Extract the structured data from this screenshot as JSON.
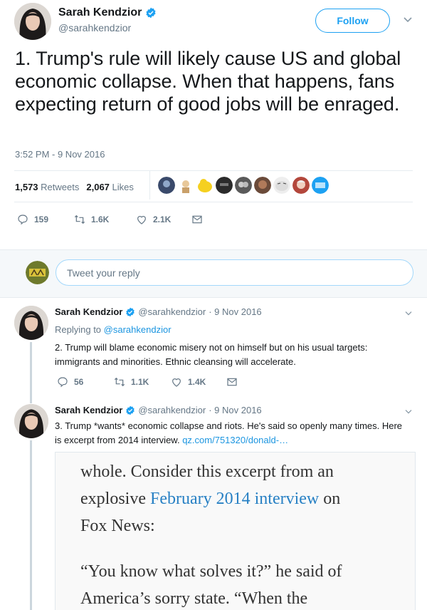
{
  "main_tweet": {
    "author_name": "Sarah Kendzior",
    "author_handle": "@sarahkendzior",
    "follow_label": "Follow",
    "text": "1. Trump's rule will likely cause US and global economic collapse. When that happens, fans expecting return of good jobs will be enraged.",
    "timestamp": "3:52 PM - 9 Nov 2016",
    "retweets_count": "1,573",
    "retweets_label": "Retweets",
    "likes_count": "2,067",
    "likes_label": "Likes",
    "reply_count": "159",
    "retweet_action_count": "1.6K",
    "like_action_count": "2.1K"
  },
  "reply_box": {
    "placeholder": "Tweet your reply"
  },
  "replies": [
    {
      "author_name": "Sarah Kendzior",
      "author_handle": "@sarahkendzior",
      "date": "· 9 Nov 2016",
      "replying_prefix": "Replying to",
      "replying_to": "@sarahkendzior",
      "text": "2. Trump will blame economic misery not on himself but on his usual targets: immigrants and minorities. Ethnic cleansing will accelerate.",
      "reply_count": "56",
      "retweet_count": "1.1K",
      "like_count": "1.4K"
    },
    {
      "author_name": "Sarah Kendzior",
      "author_handle": "@sarahkendzior",
      "date": "· 9 Nov 2016",
      "text": "3. Trump *wants* economic collapse and riots. He's said so openly many times. Here is excerpt from 2014 interview.",
      "link": "qz.com/751320/donald-…",
      "card": {
        "line1": "whole. Consider this excerpt from an",
        "line2_prefix": "explosive",
        "line2_link": "February 2014 interview",
        "line2_suffix": "on",
        "line3": "Fox News:",
        "line4": "“You know what solves it?” he said of",
        "line5": "America’s sorry state. “When the"
      }
    }
  ],
  "colors": {
    "accent": "#1da1f2",
    "link": "#1b95e0",
    "muted": "#657786",
    "thread_line": "#ccd6dd"
  },
  "icons": [
    "verified-badge-icon",
    "chevron-down-icon",
    "reply-icon",
    "retweet-icon",
    "like-icon",
    "direct-message-icon"
  ]
}
